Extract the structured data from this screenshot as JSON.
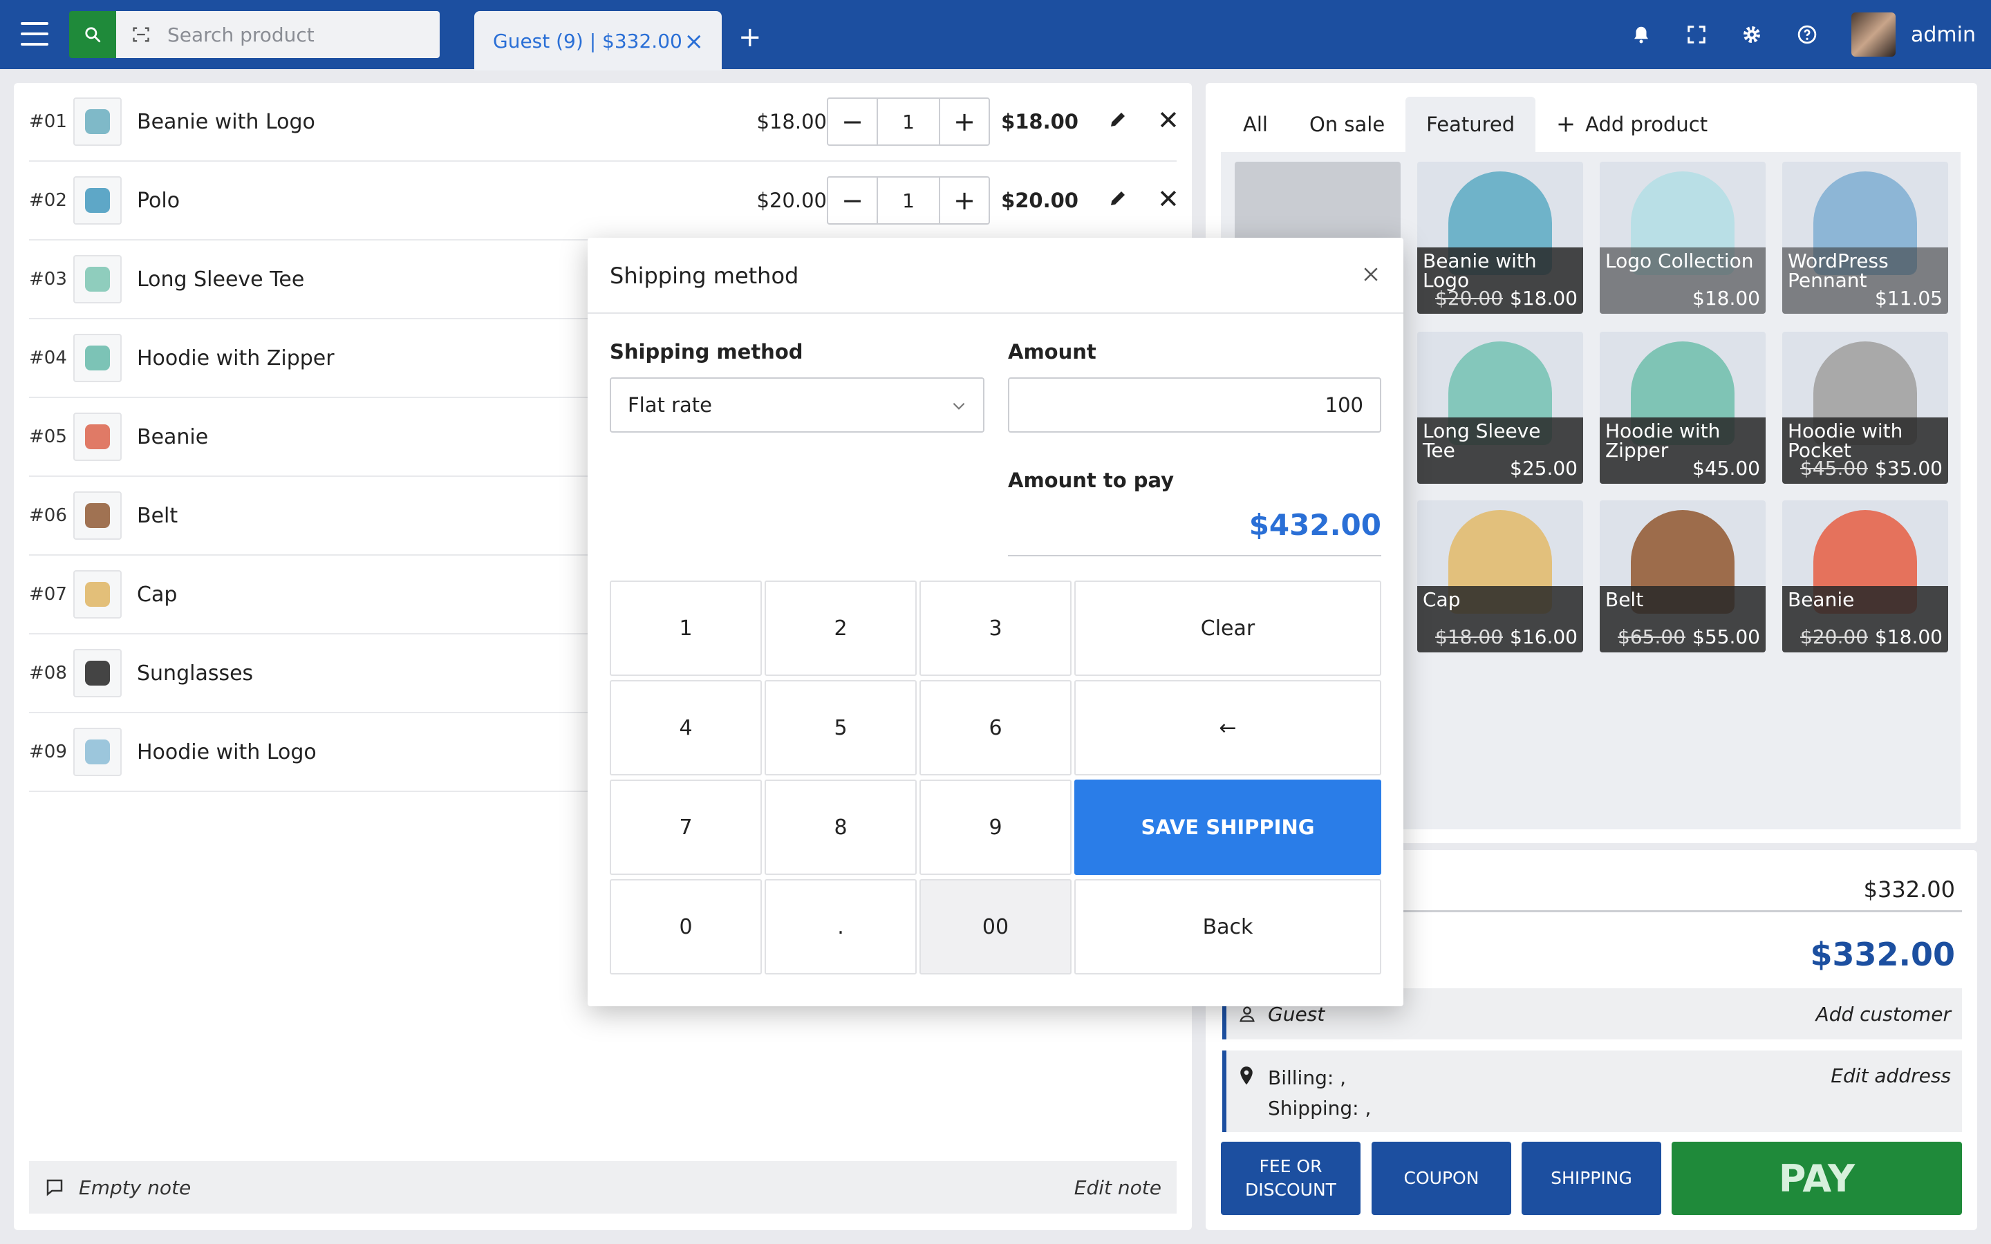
{
  "header": {
    "search_placeholder": "Search product",
    "order_tab": "Guest (9) | $332.00",
    "close_tab": "×",
    "add_tab": "+",
    "username": "admin"
  },
  "cart": {
    "items": [
      {
        "num": "#01",
        "name": "Beanie with Logo",
        "price": "$18.00",
        "qty": "1",
        "total": "$18.00",
        "color": "#7fb9c8"
      },
      {
        "num": "#02",
        "name": "Polo",
        "price": "$20.00",
        "qty": "1",
        "total": "$20.00",
        "color": "#5ea7c7"
      },
      {
        "num": "#03",
        "name": "Long Sleeve Tee",
        "color": "#8fcdbd"
      },
      {
        "num": "#04",
        "name": "Hoodie with Zipper",
        "color": "#7cc3b6"
      },
      {
        "num": "#05",
        "name": "Beanie",
        "color": "#e07a66"
      },
      {
        "num": "#06",
        "name": "Belt",
        "color": "#a07252"
      },
      {
        "num": "#07",
        "name": "Cap",
        "color": "#e3bf79"
      },
      {
        "num": "#08",
        "name": "Sunglasses",
        "color": "#444444"
      },
      {
        "num": "#09",
        "name": "Hoodie with Logo",
        "color": "#9cc6dc"
      }
    ],
    "qty_minus": "−",
    "qty_plus": "+",
    "remove": "✕",
    "note": "Empty note",
    "edit_note": "Edit note"
  },
  "products": {
    "filters": [
      "All",
      "On sale",
      "Featured",
      "Add product"
    ],
    "tiles": [
      {
        "name": "Beanie with Logo",
        "old": "$20.00",
        "price": "$18.00",
        "color": "#6fb3c9"
      },
      {
        "name": "Logo Collection",
        "old": "",
        "price": "$18.00",
        "color": "#b9dfe6"
      },
      {
        "name": "WordPress Pennant",
        "old": "",
        "price": "$11.05",
        "color": "#8db6d6"
      },
      {
        "name": "Long Sleeve Tee",
        "old": "",
        "price": "$25.00",
        "color": "#84c7bb"
      },
      {
        "name": "Hoodie with Zipper",
        "old": "",
        "price": "$45.00",
        "color": "#7fc4b5"
      },
      {
        "name": "Hoodie with Pocket",
        "old": "$45.00",
        "price": "$35.00",
        "color": "#a9a9a9"
      },
      {
        "name": "Cap",
        "old": "$18.00",
        "price": "$16.00",
        "color": "#e2c07c"
      },
      {
        "name": "Belt",
        "old": "$65.00",
        "price": "$55.00",
        "color": "#9d6c4b"
      },
      {
        "name": "Beanie",
        "old": "$20.00",
        "price": "$18.00",
        "color": "#e5725c"
      }
    ]
  },
  "totals": {
    "subtotal": "$332.00",
    "grand_total": "$332.00",
    "customer": "Guest",
    "add_customer": "Add customer",
    "billing": "Billing: ,",
    "shipping": "Shipping: ,",
    "edit_address": "Edit address",
    "fee_line1": "FEE OR",
    "fee_line2": "DISCOUNT",
    "coupon": "COUPON",
    "shipping_btn": "SHIPPING",
    "pay": "PAY"
  },
  "modal": {
    "title": "Shipping method",
    "method_label": "Shipping method",
    "method_value": "Flat rate",
    "amount_label": "Amount",
    "amount_value": "100",
    "to_pay_label": "Amount to pay",
    "to_pay_value": "$432.00",
    "keys": {
      "k1": "1",
      "k2": "2",
      "k3": "3",
      "clear": "Clear",
      "k4": "4",
      "k5": "5",
      "k6": "6",
      "backspace": "←",
      "k7": "7",
      "k8": "8",
      "k9": "9",
      "save": "SAVE SHIPPING",
      "k0": "0",
      "dot": ".",
      "k00": "00",
      "back": "Back"
    }
  },
  "colors": {
    "header": "#1c4fa0",
    "accent": "#2a7de8",
    "pay": "#1f8a3a"
  }
}
